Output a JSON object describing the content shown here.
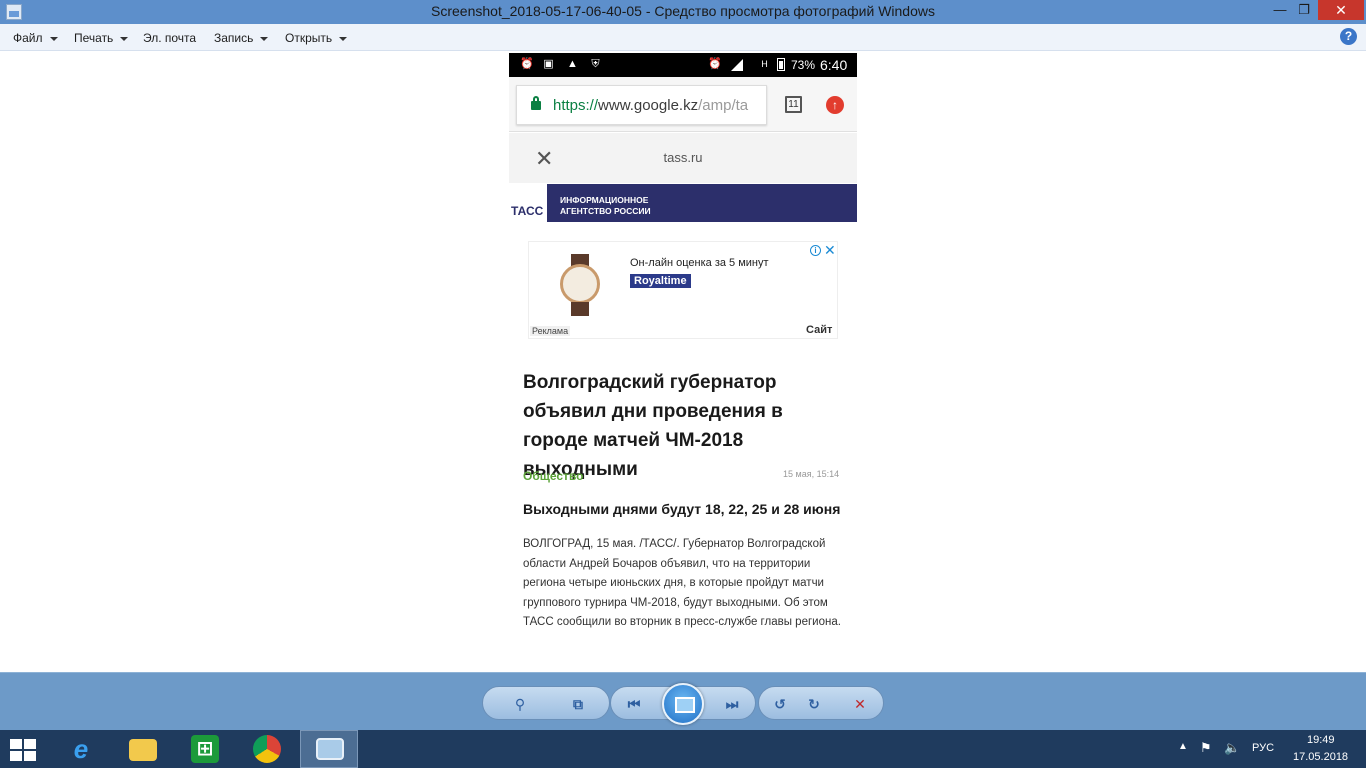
{
  "window": {
    "title": "Screenshot_2018-05-17-06-40-05 - Средство просмотра фотографий Windows",
    "min_glyph": "—",
    "max_glyph": "❐",
    "close_glyph": "✕"
  },
  "menu": {
    "file": "Файл",
    "print": "Печать",
    "email": "Эл. почта",
    "burn": "Запись",
    "open": "Открыть",
    "help": "?"
  },
  "phone": {
    "statusbar": {
      "battery_pct": "73%",
      "time": "6:40",
      "signal_label": "H",
      "icons": [
        "alarm-icon",
        "image-icon",
        "app-icon",
        "shield-icon",
        "alarm-icon",
        "signal-icon",
        "battery-icon"
      ]
    },
    "browser": {
      "url_scheme": "https://",
      "url_host": "www.google.kz",
      "url_path": "/amp/ta",
      "tab_count": "11"
    },
    "amp": {
      "close_glyph": "✕",
      "domain": "tass.ru"
    },
    "tass": {
      "logo": "ТАСС",
      "tagline_line1": "ИНФОРМАЦИОННОЕ",
      "tagline_line2": "АГЕНТСТВО РОССИИ",
      "color": "#2c2f6b"
    },
    "ad": {
      "text": "Он-лайн оценка за 5 минут",
      "brand": "Royaltime",
      "label": "Реклама",
      "site": "Сайт",
      "info_glyph": "i",
      "close_glyph": "✕"
    },
    "article": {
      "headline": "Волгоградский губернатор объявил дни проведения в городе матчей ЧМ-2018 выходными",
      "category": "Общество",
      "date": "15 мая, 15:14",
      "subhead": "Выходными днями будут 18, 22, 25 и 28 июня",
      "body": "ВОЛГОГРАД, 15 мая. /ТАСС/. Губернатор Волгоградской области Андрей Бочаров объявил, что на территории региона четыре июньских дня, в которые пройдут матчи группового турнира ЧМ-2018, будут выходными. Об этом ТАСС сообщили во вторник в пресс-службе главы региона.",
      "category_color": "#5da33a"
    }
  },
  "toolbar": {
    "zoom": "⚲",
    "fit": "⧉",
    "prev": "⏮",
    "next": "⏭",
    "rotate_ccw": "↺",
    "rotate_cw": "↻",
    "delete": "✕"
  },
  "taskbar": {
    "lang": "РУС",
    "time": "19:49",
    "date": "17.05.2018",
    "ie_glyph": "e",
    "store_glyph": "⊞"
  }
}
